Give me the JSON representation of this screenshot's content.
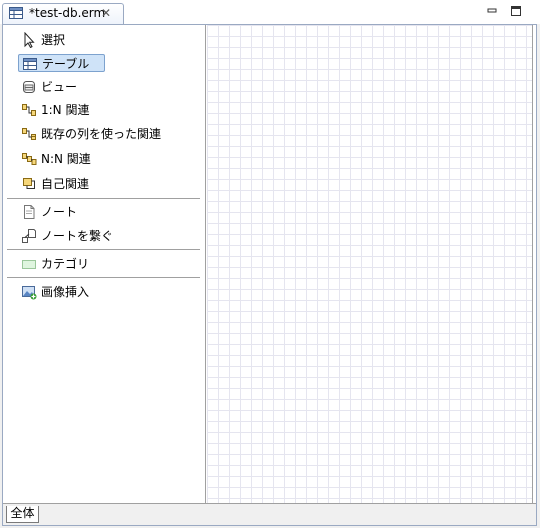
{
  "tab": {
    "title": "*test-db.erm",
    "close_glyph": "✕"
  },
  "palette": {
    "items": [
      {
        "label": "選択",
        "icon": "arrow-pointer-icon"
      },
      {
        "label": "テーブル",
        "icon": "table-icon"
      },
      {
        "label": "ビュー",
        "icon": "view-icon"
      },
      {
        "label": "1:N 関連",
        "icon": "relation-1n-icon"
      },
      {
        "label": "既存の列を使った関連",
        "icon": "relation-existing-column-icon"
      },
      {
        "label": "N:N 関連",
        "icon": "relation-nn-icon"
      },
      {
        "label": "自己関連",
        "icon": "self-relation-icon"
      },
      {
        "label": "ノート",
        "icon": "note-icon"
      },
      {
        "label": "ノートを繋ぐ",
        "icon": "note-connect-icon"
      },
      {
        "label": "カテゴリ",
        "icon": "category-icon"
      },
      {
        "label": "画像挿入",
        "icon": "insert-image-icon"
      }
    ],
    "selected_index": 1
  },
  "bottom_tabs": {
    "all": "全体"
  },
  "colors": {
    "selection_bg": "#cfe3f8",
    "selection_border": "#7da2ce",
    "grid": "#e5e5ef",
    "tab_border": "#9aa9c2"
  }
}
